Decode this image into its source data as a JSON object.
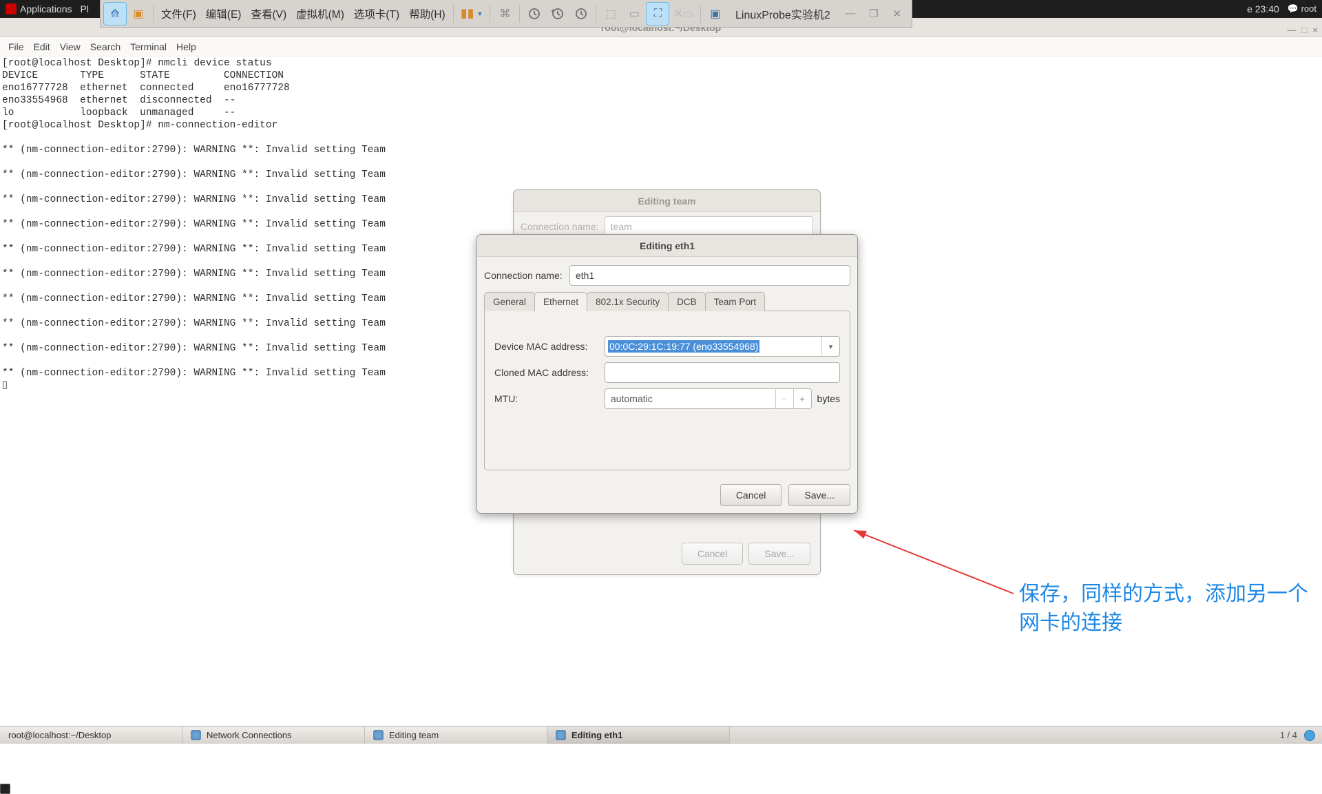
{
  "gnome": {
    "applications": "Applications",
    "pl": "Pl",
    "clock": "e 23:40",
    "user": "root"
  },
  "vmware": {
    "menus": [
      "文件(F)",
      "编辑(E)",
      "查看(V)",
      "虚拟机(M)",
      "选项卡(T)",
      "帮助(H)"
    ],
    "vm_title": "LinuxProbe实验机2"
  },
  "terminal": {
    "title": "root@localhost:~/Desktop",
    "menus": [
      "File",
      "Edit",
      "View",
      "Search",
      "Terminal",
      "Help"
    ],
    "content": "[root@localhost Desktop]# nmcli device status\nDEVICE       TYPE      STATE         CONNECTION\neno16777728  ethernet  connected     eno16777728\neno33554968  ethernet  disconnected  --\nlo           loopback  unmanaged     --\n[root@localhost Desktop]# nm-connection-editor\n\n** (nm-connection-editor:2790): WARNING **: Invalid setting Team\n\n** (nm-connection-editor:2790): WARNING **: Invalid setting Team\n\n** (nm-connection-editor:2790): WARNING **: Invalid setting Team\n\n** (nm-connection-editor:2790): WARNING **: Invalid setting Team\n\n** (nm-connection-editor:2790): WARNING **: Invalid setting Team\n\n** (nm-connection-editor:2790): WARNING **: Invalid setting Team\n\n** (nm-connection-editor:2790): WARNING **: Invalid setting Team\n\n** (nm-connection-editor:2790): WARNING **: Invalid setting Team\n\n** (nm-connection-editor:2790): WARNING **: Invalid setting Team\n\n** (nm-connection-editor:2790): WARNING **: Invalid setting Team\n▯"
  },
  "dialog_back": {
    "title": "Editing team",
    "conn_label": "Connection name:",
    "conn_value": "team",
    "cancel": "Cancel",
    "save": "Save..."
  },
  "dialog": {
    "title": "Editing eth1",
    "conn_label": "Connection name:",
    "conn_value": "eth1",
    "tabs": [
      "General",
      "Ethernet",
      "802.1x Security",
      "DCB",
      "Team Port"
    ],
    "active_tab": 1,
    "fields": {
      "device_mac_label": "Device MAC address:",
      "device_mac_value": "00:0C:29:1C:19:77 (eno33554968)",
      "cloned_mac_label": "Cloned MAC address:",
      "cloned_mac_value": "",
      "mtu_label": "MTU:",
      "mtu_value": "automatic",
      "mtu_unit": "bytes"
    },
    "cancel": "Cancel",
    "save": "Save..."
  },
  "annotation": "保存，同样的方式，添加另一个网卡的连接",
  "taskbar": {
    "items": [
      {
        "label": "root@localhost:~/Desktop",
        "kind": "term"
      },
      {
        "label": "Network Connections",
        "kind": "net"
      },
      {
        "label": "Editing team",
        "kind": "net"
      },
      {
        "label": "Editing eth1",
        "kind": "net",
        "active": true
      }
    ],
    "pager": "1 / 4"
  }
}
